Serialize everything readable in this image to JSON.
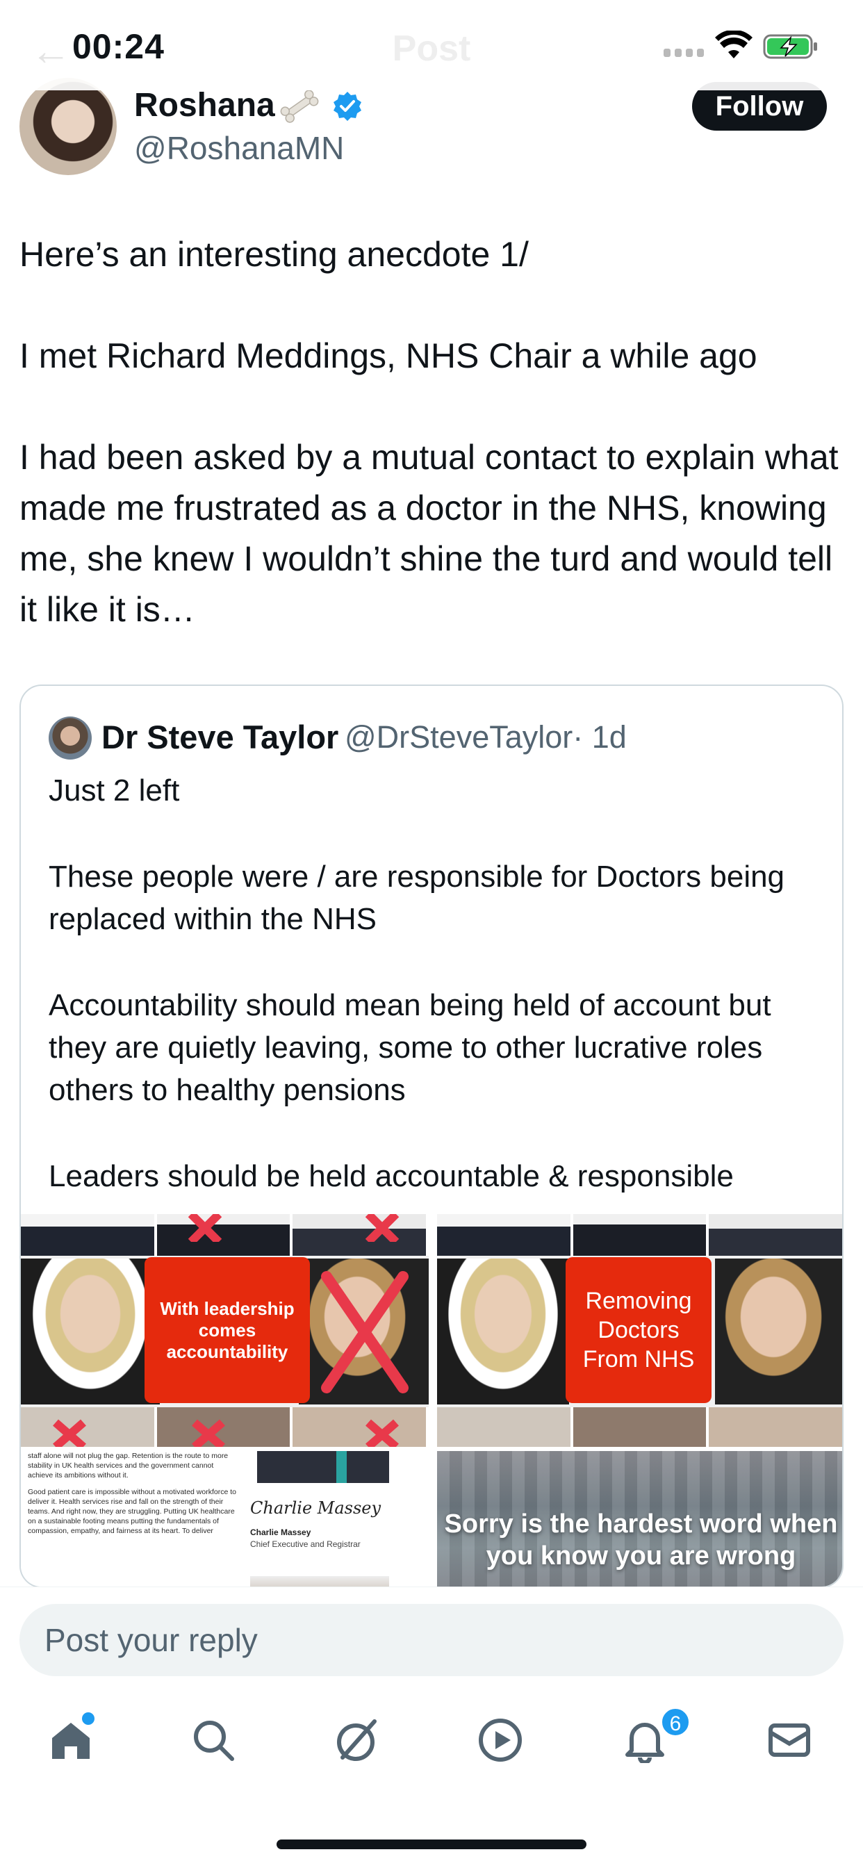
{
  "status_bar": {
    "time": "00:24"
  },
  "header": {
    "back_label": "←",
    "title": "Post"
  },
  "post": {
    "author_name": "Roshana",
    "author_handle": "@RoshanaMN",
    "follow_label": "Follow",
    "body": [
      "Here’s an interesting anecdote 1/",
      "I met Richard Meddings, NHS Chair a while ago",
      "I had been asked by a mutual contact to explain what made me frustrated as a doctor in the NHS, knowing me, she knew I wouldn’t shine the turd and would tell it like it is…"
    ]
  },
  "quote": {
    "author_name": "Dr Steve Taylor",
    "author_handle": "@DrSteveTaylor",
    "time": "· 1d",
    "body": [
      "Just 2 left",
      "These people were / are responsible for Doctors being replaced within the NHS",
      "Accountability should mean being held of account but they are quietly leaving, some to other lucrative roles others to healthy pensions",
      "Leaders should be held accountable & responsible"
    ],
    "media": {
      "image1_text": "With leadership comes accountability",
      "image2_text": "Removing Doctors From NHS",
      "image3_letter": [
        "staff alone will not plug the gap. Retention is the route to more stability in UK health services and the government cannot achieve its ambitions without it.",
        "Good patient care is impossible without a motivated workforce to deliver it. Health services rise and fall on the strength of their teams. And right now, they are struggling. Putting UK healthcare on a sustainable footing means putting the fundamentals of compassion, empathy, and fairness at its heart. To deliver"
      ],
      "image3_signature": "Charlie Massey",
      "image3_name": "Charlie Massey",
      "image3_role": "Chief Executive and Registrar",
      "image4_text": "Sorry is the hardest word when you know you are wrong"
    }
  },
  "reply": {
    "placeholder": "Post your reply"
  },
  "nav": {
    "notifications_badge": "6"
  },
  "icons": {
    "verified": "verified-badge-icon",
    "bone": "bone-emoji-icon",
    "home": "home-icon",
    "search": "search-icon",
    "grok": "grok-icon",
    "video": "play-icon",
    "notifications": "bell-icon",
    "messages": "mail-icon"
  },
  "colors": {
    "accent": "#1d9bf0",
    "text": "#0f1419",
    "secondary": "#536471",
    "banner_red": "#e52a0d"
  }
}
